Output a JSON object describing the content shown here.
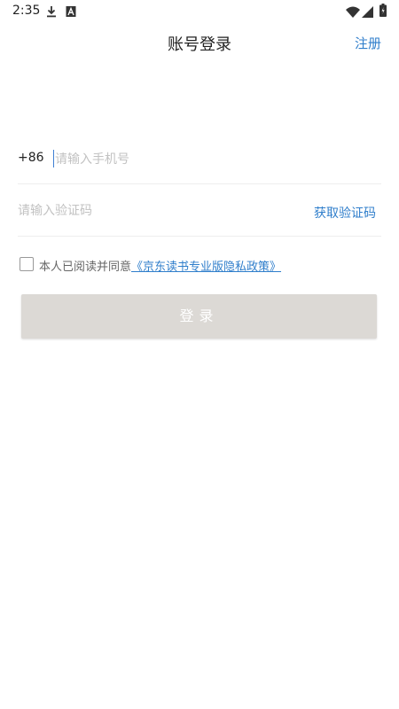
{
  "status_bar": {
    "time": "2:35",
    "icons": [
      "download-icon",
      "a-notification-icon",
      "wifi-icon",
      "signal-icon",
      "battery-icon"
    ]
  },
  "header": {
    "title": "账号登录",
    "register_label": "注册"
  },
  "phone_field": {
    "prefix": "+86",
    "placeholder": "请输入手机号",
    "value": ""
  },
  "code_field": {
    "placeholder": "请输入验证码",
    "value": "",
    "get_code_label": "获取验证码"
  },
  "agreement": {
    "checked": false,
    "text": "本人已阅读并同意",
    "link_text": "《京东读书专业版隐私政策》"
  },
  "login_button": {
    "label": "登录"
  },
  "colors": {
    "accent": "#2f7ecb",
    "button_disabled": "#dcd9d5",
    "placeholder": "#c2c2c2"
  }
}
